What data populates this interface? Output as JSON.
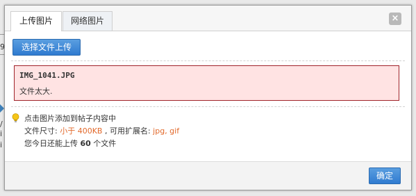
{
  "background_page": {
    "fragment_top": "9",
    "fragment_mid": "/",
    "fragment_low1": "i",
    "fragment_low2": "i"
  },
  "dialog": {
    "tabs": [
      {
        "label": "上传图片",
        "active": true
      },
      {
        "label": "网络图片",
        "active": false
      }
    ],
    "close_label": "×",
    "upload_button_label": "选择文件上传",
    "error": {
      "filename": "IMG_1041.JPG",
      "message": "文件太大."
    },
    "tips": {
      "icon": "lightbulb-icon",
      "line1": "点击图片添加到帖子内容中",
      "size_label": "文件尺寸: ",
      "size_value": "小于 400KB",
      "ext_label": " , 可用扩展名: ",
      "ext_value": "jpg, gif",
      "quota_prefix": "您今日还能上传 ",
      "quota_count": "60",
      "quota_suffix": " 个文件"
    },
    "confirm_label": "确定"
  },
  "colors": {
    "accent_blue": "#2f7bd0",
    "error_bg": "#ffe3e3",
    "error_border": "#a0232a",
    "highlight_orange": "#e2692b"
  }
}
